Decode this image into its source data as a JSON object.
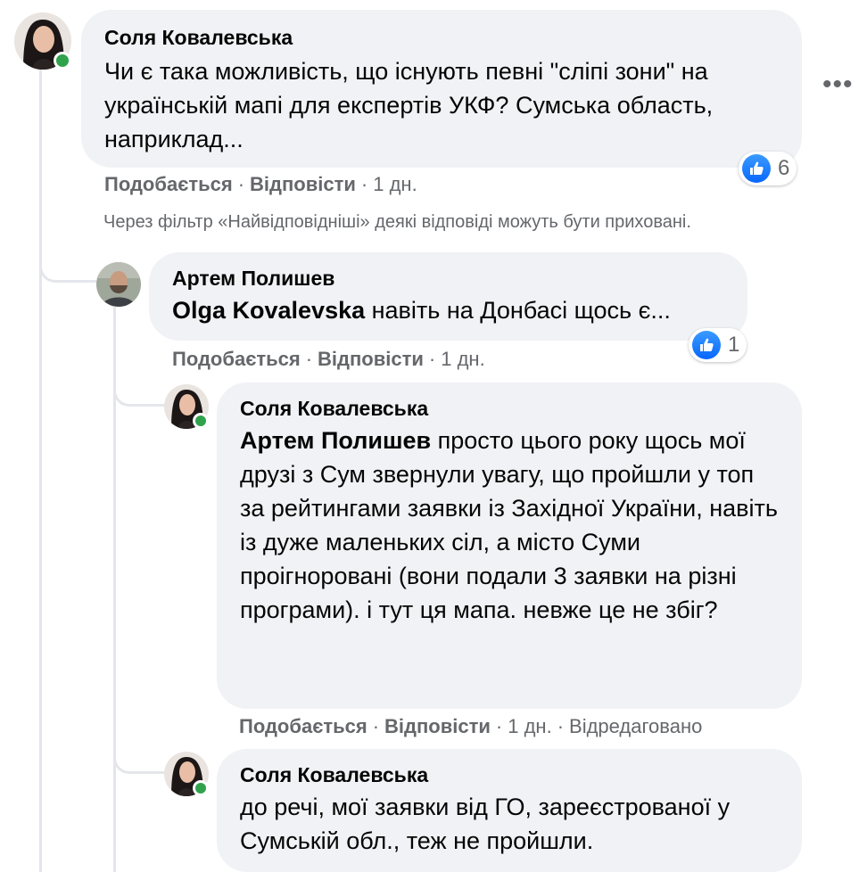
{
  "comments": [
    {
      "author": "Соля Ковалевська",
      "text": "Чи є така можливість, що існують певні \"сліпі зони\" на українській мапі для експертів УКФ? Сумська область, наприклад...",
      "like_label": "Подобається",
      "reply_label": "Відповісти",
      "time": "1 дн.",
      "reaction_count": "6",
      "more_icon": "more-horizontal-icon"
    },
    {
      "author": "Артем Полишев",
      "mention": "Olga Kovalevska",
      "text": " навіть на Донбасі щось є...",
      "like_label": "Подобається",
      "reply_label": "Відповісти",
      "time": "1 дн.",
      "reaction_count": "1"
    },
    {
      "author": "Соля Ковалевська",
      "mention": "Артем Полишев",
      "text": " просто цього року щось мої друзі з Сум звернули увагу, що пройшли у топ за рейтингами заявки із Західної України, навіть із дуже маленьких сіл, а місто Суми проігноровані (вони подали 3 заявки на різні програми). і тут ця мапа. невже це не збіг?",
      "like_label": "Подобається",
      "reply_label": "Відповісти",
      "time": "1 дн.",
      "edited": "Відредаговано"
    },
    {
      "author": "Соля Ковалевська",
      "text": "до речі, мої заявки від ГО, зареєстрованої у Сумській обл., теж не пройшли."
    }
  ],
  "filter_note": "Через фільтр «Найвідповідніші» деякі відповіді можуть бути приховані.",
  "separator": "·",
  "colors": {
    "bubble": "#f0f2f5",
    "meta": "#65676b",
    "online": "#31a24c",
    "like": "#0866ff"
  }
}
